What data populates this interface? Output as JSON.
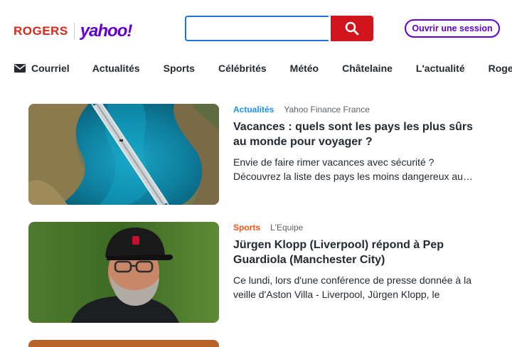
{
  "header": {
    "logo_rogers": "ROGERS",
    "logo_yahoo": "yahoo!",
    "search_placeholder": "",
    "search_value": "",
    "signin_label": "Ouvrir une session"
  },
  "nav": {
    "items": [
      {
        "label": "Courriel",
        "icon": "mail-icon"
      },
      {
        "label": "Actualités"
      },
      {
        "label": "Sports"
      },
      {
        "label": "Célébrités"
      },
      {
        "label": "Météo"
      },
      {
        "label": "Châtelaine"
      },
      {
        "label": "L'actualité"
      },
      {
        "label": "Rogers"
      }
    ]
  },
  "articles": [
    {
      "category": "Actualités",
      "category_color": "#188fff",
      "source": "Yahoo Finance France",
      "title": "Vacances : quels sont les pays les plus sûrs au monde pour voyager ?",
      "summary": "Envie de faire rimer vacances avec sécurité ? Découvrez la liste des pays les moins dangereux au…",
      "image": "aerial-bridge-over-river-photo"
    },
    {
      "category": "Sports",
      "category_color": "#ff520d",
      "source": "L'Equipe",
      "title": "Jürgen Klopp (Liverpool) répond à Pep Guardiola (Manchester City)",
      "summary": "Ce lundi, lors d'une conférence de presse donnée à la veille d'Aston Villa - Liverpool, Jürgen Klopp, le manag…",
      "image": "coach-portrait-photo"
    }
  ],
  "colors": {
    "brand_purple": "#6001d2",
    "rogers_red": "#da291c",
    "search_red": "#d1151c"
  }
}
